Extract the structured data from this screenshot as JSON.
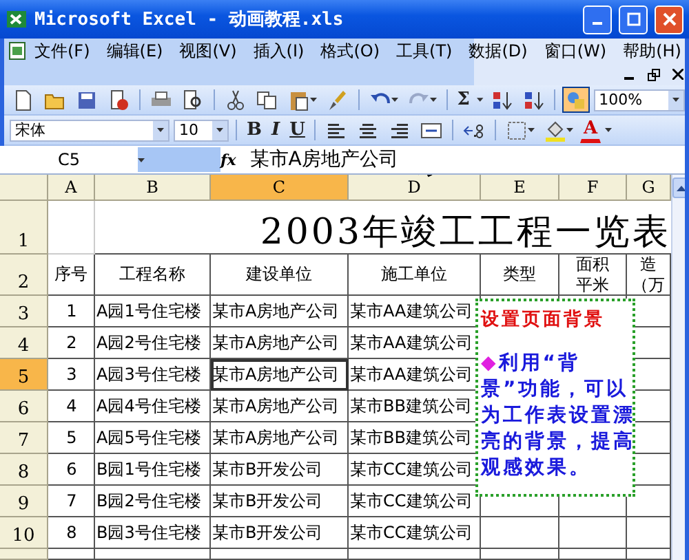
{
  "window": {
    "title": "Microsoft Excel - 动画教程.xls"
  },
  "menu": [
    {
      "label": "文件(F)"
    },
    {
      "label": "编辑(E)"
    },
    {
      "label": "视图(V)"
    },
    {
      "label": "插入(I)"
    },
    {
      "label": "格式(O)"
    },
    {
      "label": "工具(T)"
    },
    {
      "label": "数据(D)"
    },
    {
      "label": "窗口(W)"
    },
    {
      "label": "帮助(H)"
    }
  ],
  "standard_toolbar": {
    "sum_symbol": "Σ",
    "drawing_selected": true,
    "zoom": "100%"
  },
  "formatting_toolbar": {
    "font": "宋体",
    "size": "10",
    "style_buttons": [
      {
        "label": "B",
        "kind": "bold"
      },
      {
        "label": "I",
        "kind": "italic"
      },
      {
        "label": "U",
        "kind": "underline"
      }
    ],
    "font_color_letter": "A"
  },
  "formula_bar": {
    "name_box": "C5",
    "function_label": "fx",
    "formula": "某市A房地产公司"
  },
  "sheet": {
    "columns": [
      {
        "label": "A",
        "selected": false
      },
      {
        "label": "B",
        "selected": false
      },
      {
        "label": "C",
        "selected": true
      },
      {
        "label": "D",
        "selected": false
      },
      {
        "label": "E",
        "selected": false
      },
      {
        "label": "F",
        "selected": false
      },
      {
        "label": "G",
        "selected": false
      }
    ],
    "title_row": {
      "number": "1",
      "title": "2003年竣工工程一览表"
    },
    "header_row": {
      "number": "2",
      "cells": [
        [
          "序号"
        ],
        [
          "工程名称"
        ],
        [
          "建设单位"
        ],
        [
          "施工单位"
        ],
        [
          "类型"
        ],
        [
          "面积",
          "平米"
        ],
        [
          "造",
          "（万"
        ]
      ]
    },
    "rows": [
      {
        "number": "3",
        "selected": false,
        "cells": [
          "1",
          "A园1号住宅楼",
          "某市A房地产公司",
          "某市AA建筑公司"
        ]
      },
      {
        "number": "4",
        "selected": false,
        "cells": [
          "2",
          "A园2号住宅楼",
          "某市A房地产公司",
          "某市AA建筑公司"
        ]
      },
      {
        "number": "5",
        "selected": true,
        "cells": [
          "3",
          "A园3号住宅楼",
          "某市A房地产公司",
          "某市AA建筑公司"
        ]
      },
      {
        "number": "6",
        "selected": false,
        "cells": [
          "4",
          "A园4号住宅楼",
          "某市A房地产公司",
          "某市BB建筑公司"
        ]
      },
      {
        "number": "7",
        "selected": false,
        "cells": [
          "5",
          "A园5号住宅楼",
          "某市A房地产公司",
          "某市BB建筑公司"
        ]
      },
      {
        "number": "8",
        "selected": false,
        "cells": [
          "6",
          "B园1号住宅楼",
          "某市B开发公司",
          "某市CC建筑公司"
        ]
      },
      {
        "number": "9",
        "selected": false,
        "cells": [
          "7",
          "B园2号住宅楼",
          "某市B开发公司",
          "某市CC建筑公司"
        ]
      },
      {
        "number": "10",
        "selected": false,
        "cells": [
          "8",
          "B园3号住宅楼",
          "某市B开发公司",
          "某市CC建筑公司"
        ]
      }
    ]
  },
  "text_box": {
    "heading": "设置页面背景",
    "bullet": "◆",
    "body": "利用“背景”功能，可以为工作表设置漂亮的背景，提高观感效果。"
  }
}
